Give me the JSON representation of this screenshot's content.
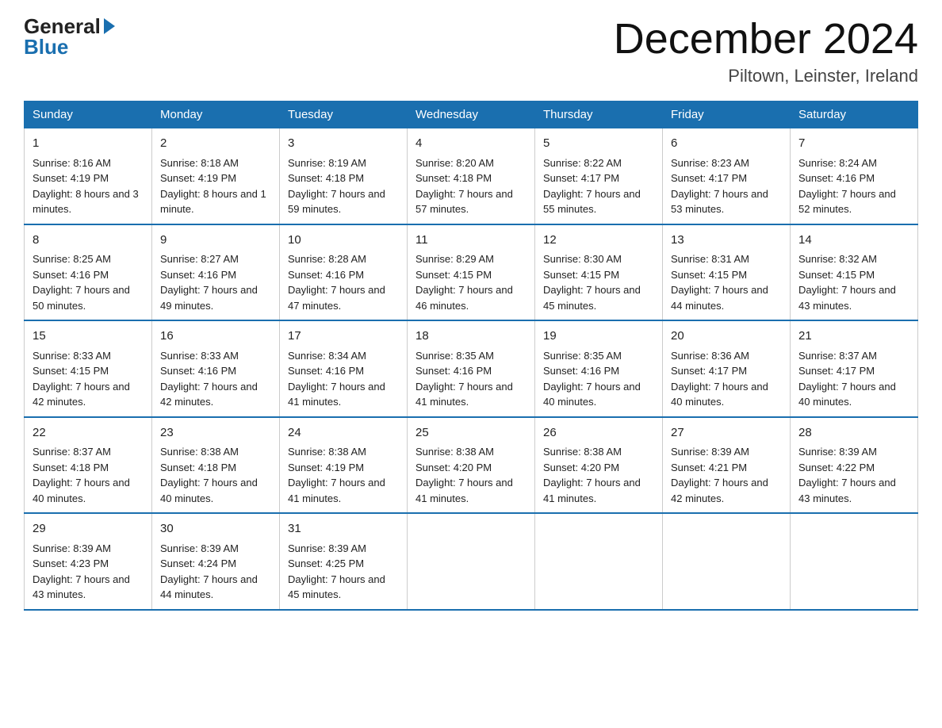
{
  "logo": {
    "name_part1": "General",
    "name_part2": "Blue"
  },
  "header": {
    "title": "December 2024",
    "location": "Piltown, Leinster, Ireland"
  },
  "days_of_week": [
    "Sunday",
    "Monday",
    "Tuesday",
    "Wednesday",
    "Thursday",
    "Friday",
    "Saturday"
  ],
  "weeks": [
    [
      {
        "day": "1",
        "sunrise": "8:16 AM",
        "sunset": "4:19 PM",
        "daylight": "8 hours and 3 minutes."
      },
      {
        "day": "2",
        "sunrise": "8:18 AM",
        "sunset": "4:19 PM",
        "daylight": "8 hours and 1 minute."
      },
      {
        "day": "3",
        "sunrise": "8:19 AM",
        "sunset": "4:18 PM",
        "daylight": "7 hours and 59 minutes."
      },
      {
        "day": "4",
        "sunrise": "8:20 AM",
        "sunset": "4:18 PM",
        "daylight": "7 hours and 57 minutes."
      },
      {
        "day": "5",
        "sunrise": "8:22 AM",
        "sunset": "4:17 PM",
        "daylight": "7 hours and 55 minutes."
      },
      {
        "day": "6",
        "sunrise": "8:23 AM",
        "sunset": "4:17 PM",
        "daylight": "7 hours and 53 minutes."
      },
      {
        "day": "7",
        "sunrise": "8:24 AM",
        "sunset": "4:16 PM",
        "daylight": "7 hours and 52 minutes."
      }
    ],
    [
      {
        "day": "8",
        "sunrise": "8:25 AM",
        "sunset": "4:16 PM",
        "daylight": "7 hours and 50 minutes."
      },
      {
        "day": "9",
        "sunrise": "8:27 AM",
        "sunset": "4:16 PM",
        "daylight": "7 hours and 49 minutes."
      },
      {
        "day": "10",
        "sunrise": "8:28 AM",
        "sunset": "4:16 PM",
        "daylight": "7 hours and 47 minutes."
      },
      {
        "day": "11",
        "sunrise": "8:29 AM",
        "sunset": "4:15 PM",
        "daylight": "7 hours and 46 minutes."
      },
      {
        "day": "12",
        "sunrise": "8:30 AM",
        "sunset": "4:15 PM",
        "daylight": "7 hours and 45 minutes."
      },
      {
        "day": "13",
        "sunrise": "8:31 AM",
        "sunset": "4:15 PM",
        "daylight": "7 hours and 44 minutes."
      },
      {
        "day": "14",
        "sunrise": "8:32 AM",
        "sunset": "4:15 PM",
        "daylight": "7 hours and 43 minutes."
      }
    ],
    [
      {
        "day": "15",
        "sunrise": "8:33 AM",
        "sunset": "4:15 PM",
        "daylight": "7 hours and 42 minutes."
      },
      {
        "day": "16",
        "sunrise": "8:33 AM",
        "sunset": "4:16 PM",
        "daylight": "7 hours and 42 minutes."
      },
      {
        "day": "17",
        "sunrise": "8:34 AM",
        "sunset": "4:16 PM",
        "daylight": "7 hours and 41 minutes."
      },
      {
        "day": "18",
        "sunrise": "8:35 AM",
        "sunset": "4:16 PM",
        "daylight": "7 hours and 41 minutes."
      },
      {
        "day": "19",
        "sunrise": "8:35 AM",
        "sunset": "4:16 PM",
        "daylight": "7 hours and 40 minutes."
      },
      {
        "day": "20",
        "sunrise": "8:36 AM",
        "sunset": "4:17 PM",
        "daylight": "7 hours and 40 minutes."
      },
      {
        "day": "21",
        "sunrise": "8:37 AM",
        "sunset": "4:17 PM",
        "daylight": "7 hours and 40 minutes."
      }
    ],
    [
      {
        "day": "22",
        "sunrise": "8:37 AM",
        "sunset": "4:18 PM",
        "daylight": "7 hours and 40 minutes."
      },
      {
        "day": "23",
        "sunrise": "8:38 AM",
        "sunset": "4:18 PM",
        "daylight": "7 hours and 40 minutes."
      },
      {
        "day": "24",
        "sunrise": "8:38 AM",
        "sunset": "4:19 PM",
        "daylight": "7 hours and 41 minutes."
      },
      {
        "day": "25",
        "sunrise": "8:38 AM",
        "sunset": "4:20 PM",
        "daylight": "7 hours and 41 minutes."
      },
      {
        "day": "26",
        "sunrise": "8:38 AM",
        "sunset": "4:20 PM",
        "daylight": "7 hours and 41 minutes."
      },
      {
        "day": "27",
        "sunrise": "8:39 AM",
        "sunset": "4:21 PM",
        "daylight": "7 hours and 42 minutes."
      },
      {
        "day": "28",
        "sunrise": "8:39 AM",
        "sunset": "4:22 PM",
        "daylight": "7 hours and 43 minutes."
      }
    ],
    [
      {
        "day": "29",
        "sunrise": "8:39 AM",
        "sunset": "4:23 PM",
        "daylight": "7 hours and 43 minutes."
      },
      {
        "day": "30",
        "sunrise": "8:39 AM",
        "sunset": "4:24 PM",
        "daylight": "7 hours and 44 minutes."
      },
      {
        "day": "31",
        "sunrise": "8:39 AM",
        "sunset": "4:25 PM",
        "daylight": "7 hours and 45 minutes."
      },
      null,
      null,
      null,
      null
    ]
  ]
}
